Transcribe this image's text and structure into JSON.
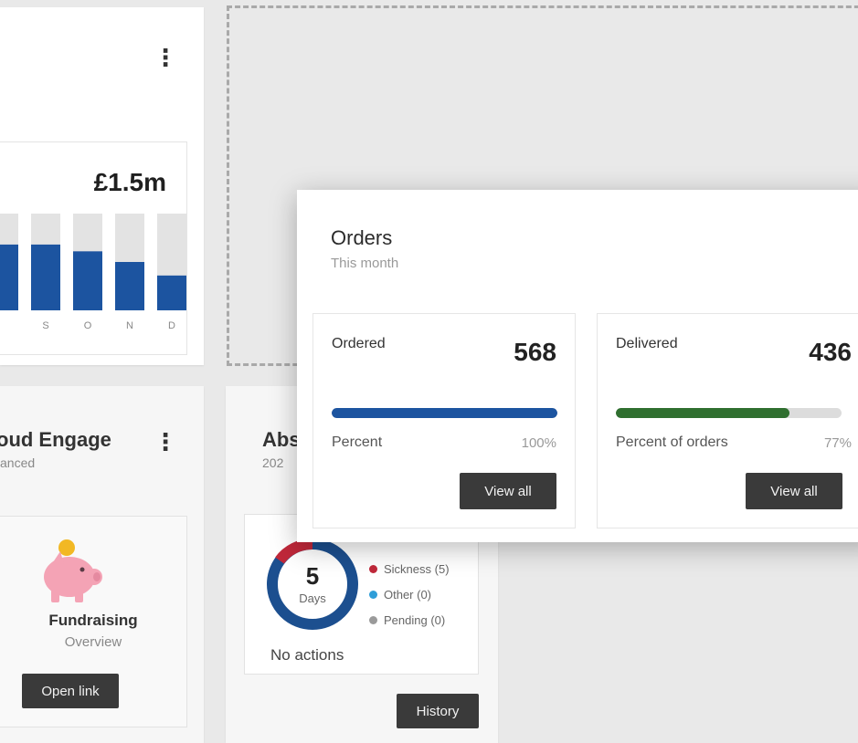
{
  "revenue_card": {
    "total": "£1.5m",
    "chart_data": {
      "type": "bar",
      "categories": [
        "",
        "S",
        "O",
        "N",
        "D"
      ],
      "values": [
        0.68,
        0.68,
        0.61,
        0.5,
        0.36
      ],
      "ylim": [
        0,
        1
      ],
      "colors": {
        "bar": "#1c54a0",
        "track": "#e3e3e3"
      }
    }
  },
  "engage_card": {
    "title": "oud Engage",
    "subtitle": "anced",
    "item": {
      "icon": "piggy-bank-icon",
      "title": "Fundraising",
      "subtitle": "Overview",
      "button_label": "Open link"
    }
  },
  "absence_card": {
    "title": "Abs",
    "subtitle": "202",
    "donut": {
      "value": "5",
      "unit": "Days"
    },
    "legend": [
      {
        "label": "Sickness (5)",
        "color": "#c0283a"
      },
      {
        "label": "Other (0)",
        "color": "#2f9ed8"
      },
      {
        "label": "Pending (0)",
        "color": "#9a9a9a"
      }
    ],
    "status": "No actions",
    "history_label": "History"
  },
  "orders_modal": {
    "title": "Orders",
    "subtitle": "This month",
    "stats": [
      {
        "label": "Ordered",
        "value": "568",
        "percent_label": "Percent",
        "percent_text": "100%",
        "percent": 100,
        "color": "#1c54a0",
        "button_label": "View all"
      },
      {
        "label": "Delivered",
        "value": "436",
        "percent_label": "Percent of orders",
        "percent_text": "77%",
        "percent": 77,
        "color": "#2f6f2f",
        "button_label": "View all"
      }
    ]
  }
}
